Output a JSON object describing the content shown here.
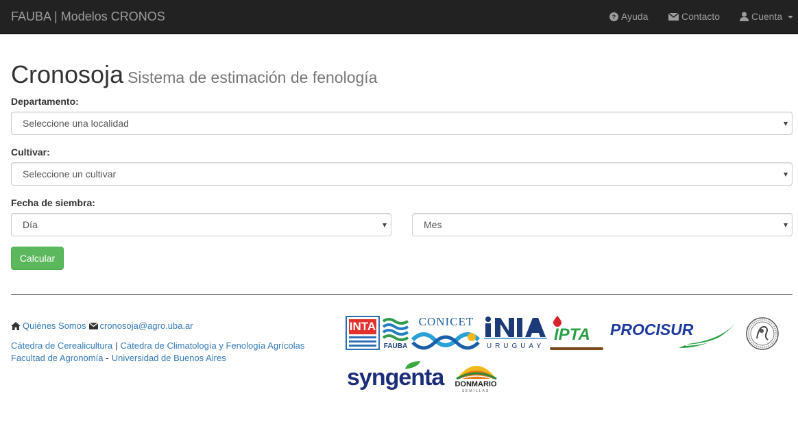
{
  "navbar": {
    "brand": "FAUBA | Modelos CRONOS",
    "items": [
      {
        "label": "Ayuda",
        "icon": "question-circle-icon"
      },
      {
        "label": "Contacto",
        "icon": "envelope-icon"
      },
      {
        "label": "Cuenta",
        "icon": "user-icon"
      }
    ]
  },
  "header": {
    "title": "Cronosoja",
    "subtitle": "Sistema de estimación de fenología"
  },
  "form": {
    "departamento": {
      "label": "Departamento:",
      "value": "Seleccione una localidad"
    },
    "cultivar": {
      "label": "Cultivar:",
      "value": "Seleccione un cultivar"
    },
    "fecha": {
      "label": "Fecha de siembra:",
      "dia": "Día",
      "mes": "Mes"
    },
    "submit_label": "Calcular"
  },
  "footer": {
    "about_label": "Quiénes Somos",
    "email": "cronosoja@agro.uba.ar",
    "link_cerealicultura": "Cátedra de Cerealicultura",
    "link_climatologia": "Cátedra de Climatología y Fenología Agrícolas",
    "link_facultad": "Facultad de Agronomía",
    "link_universidad": "Universidad de Buenos Aires",
    "pipe": "|",
    "dash": "-"
  },
  "logos": {
    "inta": "INTA",
    "fauba": "FAUBA",
    "conicet": "CONICET",
    "inia": "INIA",
    "inia_country": "URUGUAY",
    "ipta": "IPTA",
    "procisur": "PROCISUR",
    "syngenta": "syngenta",
    "donmario": "DONMARIO",
    "donmario_sub": "SEMILLAS"
  },
  "colors": {
    "navbar_bg": "#222222",
    "link": "#337ab7",
    "success": "#5cb85c"
  }
}
